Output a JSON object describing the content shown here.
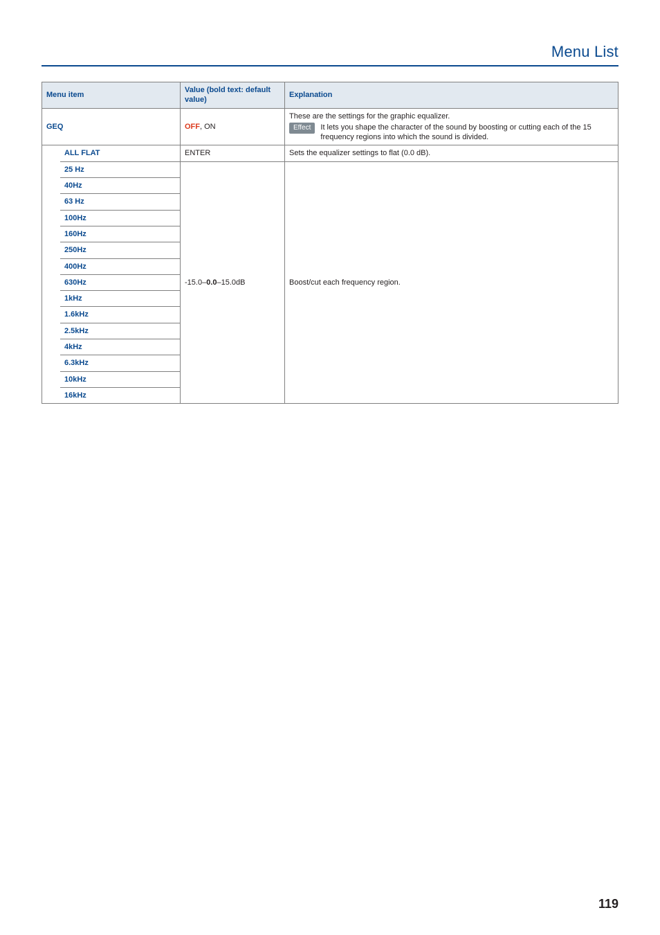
{
  "header": {
    "title": "Menu List"
  },
  "columns": {
    "menu": "Menu item",
    "value": "Value (bold text: default value)",
    "explanation": "Explanation"
  },
  "rows": {
    "geq": {
      "name": "GEQ",
      "value_off": "OFF",
      "value_sep": ", ",
      "value_on": "ON",
      "expl_line1": "These are the settings for the graphic equalizer.",
      "badge": "Effect",
      "expl_note": "It lets you shape the character of the sound by boosting or cutting each of the 15 frequency regions into which the sound is divided."
    },
    "allflat": {
      "name": "ALL FLAT",
      "value": "ENTER",
      "expl": "Sets the equalizer settings to flat (0.0 dB)."
    },
    "freq": {
      "value_pre": "-15.0–",
      "value_bold": "0.0",
      "value_post": "–15.0dB",
      "expl": "Boost/cut each frequency region.",
      "bands": [
        "25 Hz",
        "40Hz",
        "63 Hz",
        "100Hz",
        "160Hz",
        "250Hz",
        "400Hz",
        "630Hz",
        "1kHz",
        "1.6kHz",
        "2.5kHz",
        "4kHz",
        "6.3kHz",
        "10kHz",
        "16kHz"
      ]
    }
  },
  "page_number": "119"
}
